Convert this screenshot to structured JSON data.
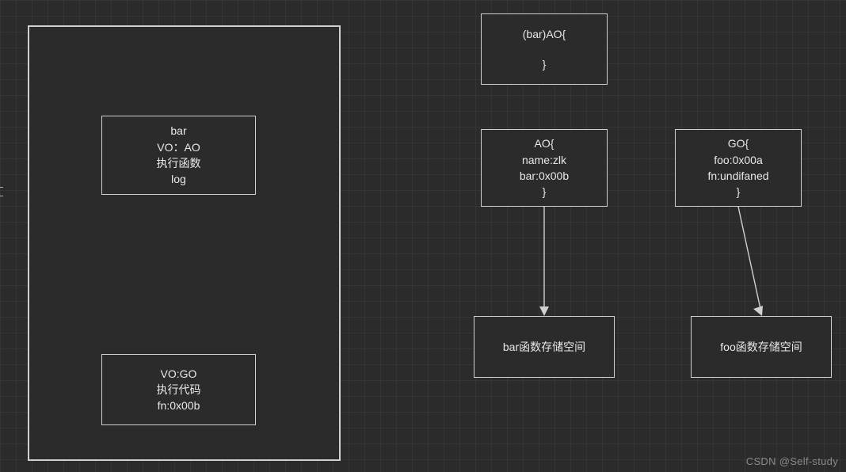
{
  "outer": {
    "barBox": {
      "l1": "bar",
      "l2": "VO：AO",
      "l3": "执行函数",
      "l4": "log"
    },
    "voBox": {
      "l1": "VO:GO",
      "l2": "执行代码",
      "l3": "fn:0x00b"
    }
  },
  "barAO": {
    "l1": "(bar)AO{",
    "l2": "}"
  },
  "AO": {
    "l1": "AO{",
    "l2": "name:zlk",
    "l3": "bar:0x00b",
    "l4": "}"
  },
  "GO": {
    "l1": "GO{",
    "l2": "foo:0x00a",
    "l3": "fn:undifaned",
    "l4": "}"
  },
  "barStorage": "bar函数存储空间",
  "fooStorage": "foo函数存储空间",
  "watermark": "CSDN @Self-study"
}
